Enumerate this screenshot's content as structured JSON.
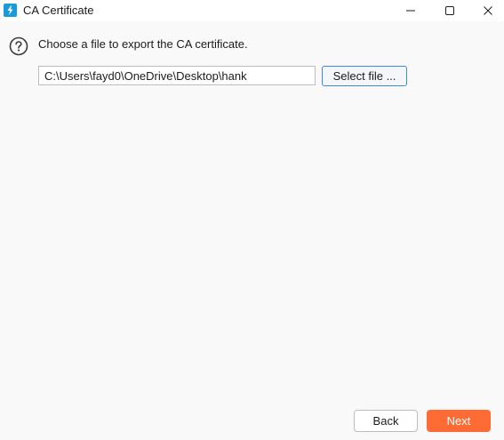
{
  "window": {
    "title": "CA Certificate",
    "app_icon": "lightning-bolt-icon",
    "controls": {
      "minimize_icon": "minimize-icon",
      "maximize_icon": "maximize-icon",
      "close_icon": "close-icon"
    }
  },
  "main": {
    "help_icon": "question-circle-icon",
    "prompt": "Choose a file to export the CA certificate.",
    "file_path": {
      "value": "C:\\Users\\fayd0\\OneDrive\\Desktop\\hank"
    },
    "select_button_label": "Select file ..."
  },
  "footer": {
    "back_label": "Back",
    "next_label": "Next"
  },
  "colors": {
    "accent": "#ff6b35",
    "app_icon_bg": "#1a9bd7",
    "focus_border": "#3c8be0",
    "background": "#f9f9f9"
  }
}
